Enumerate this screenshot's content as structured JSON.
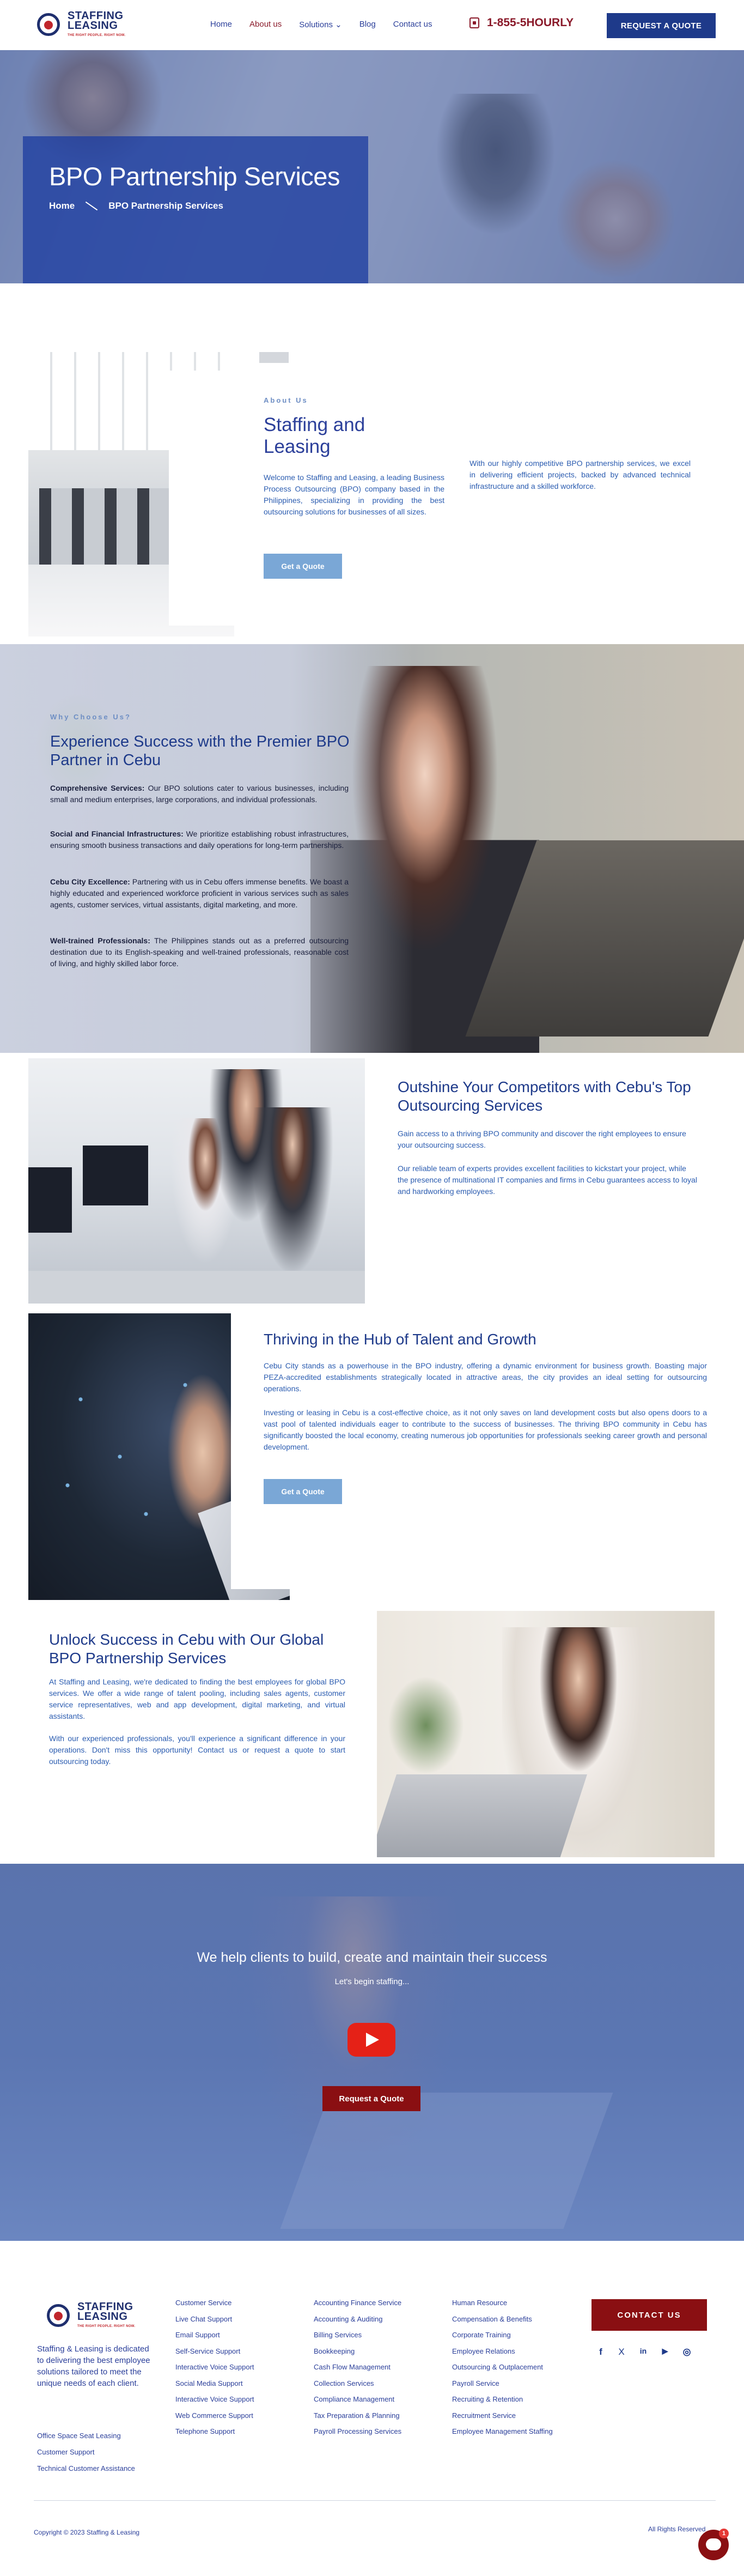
{
  "header": {
    "logo_text": "STAFFING\nLEASING",
    "nav": [
      "Home",
      "About us",
      "Solutions",
      "Blog",
      "Contact us"
    ],
    "nav_active": "About us",
    "phone": "1-855-5HOURLY",
    "request_button": "REQUEST A QUOTE"
  },
  "hero": {
    "title": "BPO Partnership Services",
    "breadcrumb": [
      "Home",
      "BPO Partnership Services"
    ]
  },
  "about": {
    "label": "About Us",
    "title": "Staffing and Leasing",
    "paragraph": "Welcome to Staffing and Leasing, a leading Business Process Outsourcing (BPO) company based in the Philippines, specializing in providing the best outsourcing solutions for businesses of all sizes.",
    "button": "Get a Quote",
    "paragraph2": "With our highly competitive BPO partnership services, we excel in delivering efficient projects, backed by advanced technical infrastructure and a skilled workforce."
  },
  "why": {
    "label": "Why Choose Us?",
    "title": "Experience Success with the Premier BPO Partner in Cebu",
    "items": [
      {
        "head": "Comprehensive Services:",
        "text": " Our BPO solutions cater to various businesses, including small and medium enterprises, large corporations, and individual professionals."
      },
      {
        "head": "Social and Financial Infrastructures:",
        "text": " We prioritize establishing robust infrastructures, ensuring smooth business transactions and daily operations for long-term partnerships."
      },
      {
        "head": "Cebu City Excellence:",
        "text": " Partnering with us in Cebu offers immense benefits. We boast a highly educated and experienced workforce proficient in various services such as sales agents, customer services, virtual assistants, digital marketing, and more."
      },
      {
        "head": "Well-trained Professionals:",
        "text": " The Philippines stands out as a preferred outsourcing destination due to its English-speaking and well-trained professionals, reasonable cost of living, and highly skilled labor force."
      }
    ]
  },
  "outshine": {
    "title": "Outshine Your Competitors with Cebu's Top Outsourcing Services",
    "p1": "Gain access to a thriving BPO community and discover the right employees to ensure your outsourcing success.",
    "p2": "Our reliable team of experts provides excellent facilities to kickstart your project, while the presence of multinational IT companies and firms in Cebu guarantees access to loyal and hardworking employees."
  },
  "thriving": {
    "title": "Thriving in the Hub of Talent and Growth",
    "p1": "Cebu City stands as a powerhouse in the BPO industry, offering a dynamic environment for business growth. Boasting major PEZA-accredited establishments strategically located in attractive areas, the city provides an ideal setting for outsourcing operations.",
    "p2": "Investing or leasing in Cebu is a cost-effective choice, as it not only saves on land development costs but also opens doors to a vast pool of talented individuals eager to contribute to the success of businesses. The thriving BPO community in Cebu has significantly boosted the local economy, creating numerous job opportunities for professionals seeking career growth and personal development.",
    "button": "Get a Quote"
  },
  "unlock": {
    "title": "Unlock Success in Cebu with Our Global BPO Partnership Services",
    "p1": "At Staffing and Leasing, we're dedicated to finding the best employees for global BPO services. We offer a wide range of talent pooling, including sales agents, customer service representatives, web and app development, digital marketing, and virtual assistants.",
    "p2": "With our experienced professionals, you'll experience a significant difference in your operations. Don't miss this opportunity! Contact us or request a quote to start outsourcing today."
  },
  "cta": {
    "heading": "We help clients to build, create and maintain their success",
    "sub": "Let's begin staffing...",
    "button": "Request a Quote"
  },
  "footer": {
    "about": "Staffing & Leasing is dedicated to delivering the best employee solutions tailored to meet the unique needs of each client.",
    "extra_links": [
      "Office Space Seat Leasing",
      "Customer Support",
      "Technical Customer Assistance"
    ],
    "col1": [
      "Customer Service",
      "Live Chat Support",
      "Email Support",
      "Self-Service Support",
      "Interactive Voice Support",
      "Social Media Support",
      "Interactive Voice Support",
      "Web Commerce Support",
      "Telephone Support"
    ],
    "col2": [
      "Accounting Finance Service",
      "Accounting & Auditing",
      "Billing Services",
      "Bookkeeping",
      "Cash Flow Management",
      "Collection Services",
      "Compliance Management",
      "Tax Preparation & Planning",
      "Payroll Processing Services"
    ],
    "col3": [
      "Human Resource",
      "Compensation & Benefits",
      "Corporate Training",
      "Employee Relations",
      "Outsourcing & Outplacement",
      "Payroll Service",
      "Recruiting & Retention",
      "Recruitment Service",
      "Employee Management Staffing"
    ],
    "contact_button": "CONTACT US",
    "social": [
      "f",
      "X",
      "in",
      "▶",
      "◎"
    ],
    "copyright": "Copyright © 2023 Staffing & Leasing",
    "rights": "All Rights Reserved",
    "chat_badge": "1"
  }
}
